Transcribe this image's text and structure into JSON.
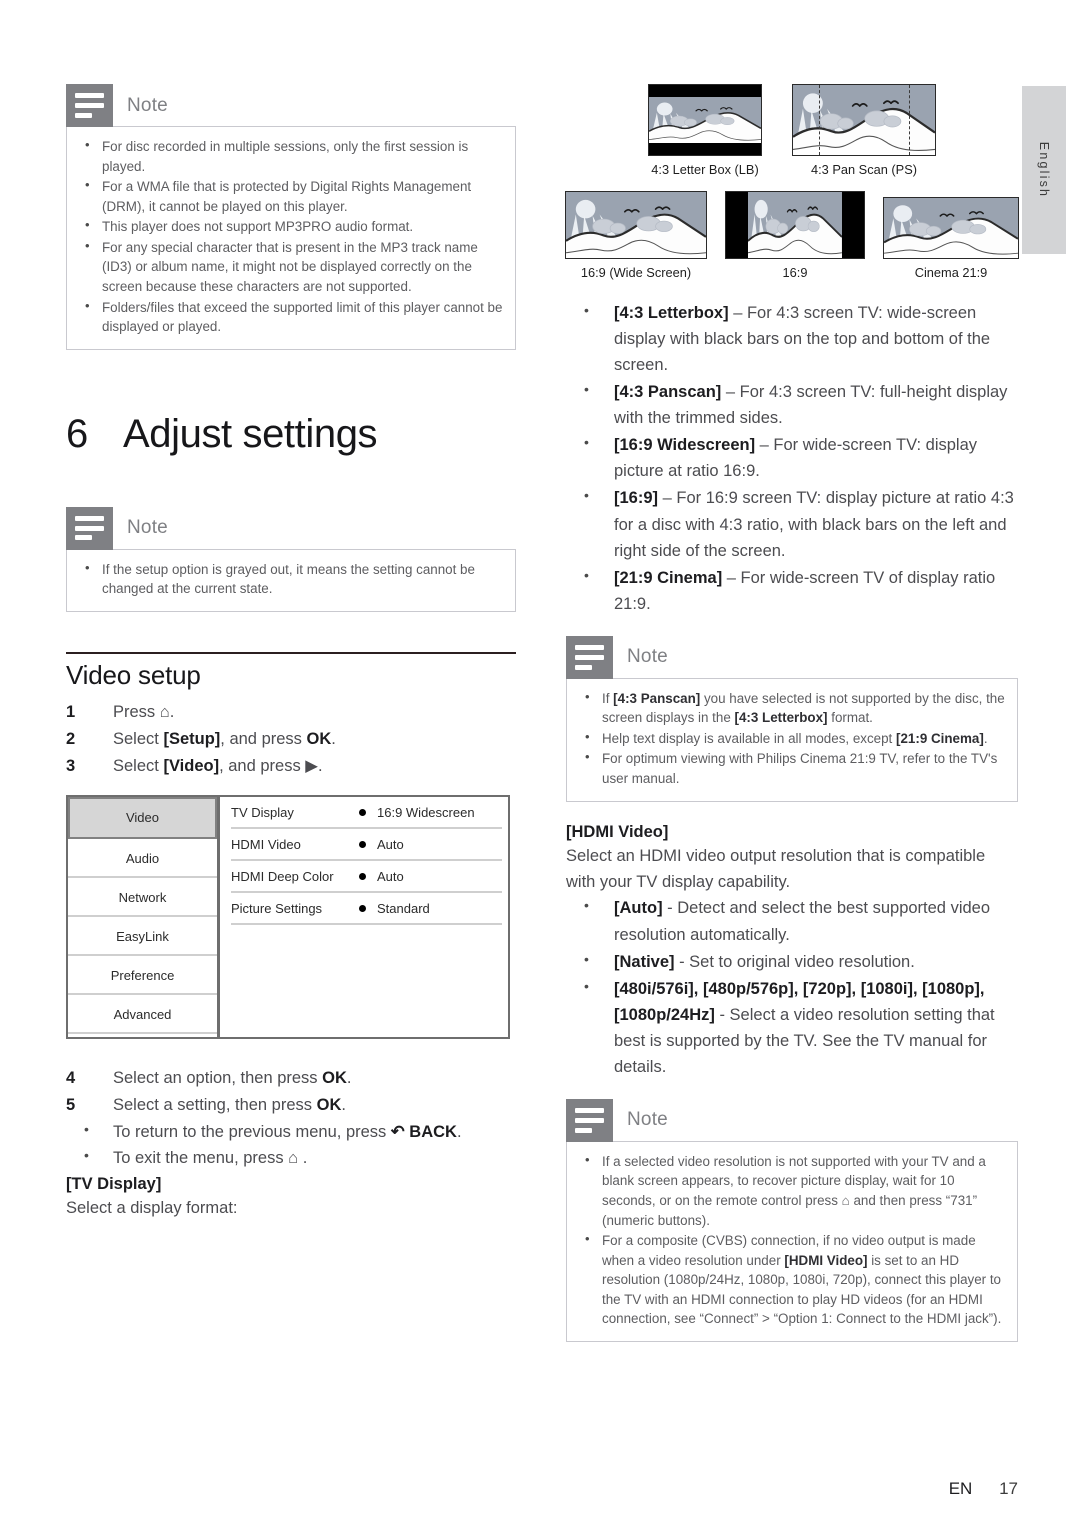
{
  "page": {
    "language_tab": "English",
    "footer_lang": "EN",
    "footer_page": "17"
  },
  "note1": {
    "title": "Note",
    "items": [
      "For disc recorded in multiple sessions, only the first session is played.",
      "For a WMA file that is protected by Digital Rights Management (DRM), it cannot be played on this player.",
      "This player does not support MP3PRO audio format.",
      "For any special character that is present in the MP3 track name (ID3) or album name, it might not be displayed correctly on the screen because these characters are not supported.",
      "Folders/files that exceed the supported limit of this player cannot be displayed or played."
    ]
  },
  "chapter": {
    "number": "6",
    "title": "Adjust settings"
  },
  "note2": {
    "title": "Note",
    "items": [
      "If the setup option is grayed out, it means the setting cannot be changed at the current state."
    ]
  },
  "video_setup": {
    "heading": "Video setup",
    "steps": [
      {
        "n": "1",
        "text": "Press ⌂."
      },
      {
        "n": "2",
        "text": "Select [Setup], and press OK."
      },
      {
        "n": "3",
        "text": "Select [Video], and press ▶."
      }
    ],
    "steps_after": [
      {
        "n": "4",
        "text": "Select an option, then press OK."
      },
      {
        "n": "5",
        "text": "Select a setting, then press OK."
      }
    ],
    "sub_bullets": [
      "To return to the previous menu, press ↶ BACK.",
      "To exit the menu, press ⌂ ."
    ]
  },
  "setup_menu": {
    "sidebar": [
      "Video",
      "Audio",
      "Network",
      "EasyLink",
      "Preference",
      "Advanced"
    ],
    "selected_sidebar": "Video",
    "rows": [
      {
        "label": "TV Display",
        "value": "16:9 Widescreen"
      },
      {
        "label": "HDMI Video",
        "value": "Auto"
      },
      {
        "label": "HDMI Deep Color",
        "value": "Auto"
      },
      {
        "label": "Picture Settings",
        "value": "Standard"
      }
    ]
  },
  "tv_display": {
    "heading": "[TV Display]",
    "intro": "Select a display format:",
    "figures_row1": [
      {
        "caption": "4:3 Letter Box (LB)",
        "mode": "letterbox"
      },
      {
        "caption": "4:3 Pan Scan (PS)",
        "mode": "panscan"
      }
    ],
    "figures_row2": [
      {
        "caption": "16:9 (Wide Screen)",
        "mode": "wide"
      },
      {
        "caption": "16:9",
        "mode": "pillarbox"
      },
      {
        "caption": "Cinema 21:9",
        "mode": "cinema"
      }
    ],
    "options": [
      {
        "term": "[4:3 Letterbox]",
        "desc": " – For 4:3 screen TV: wide-screen display with black bars on the top and bottom of the screen."
      },
      {
        "term": "[4:3 Panscan]",
        "desc": " – For 4:3 screen TV: full-height display with the trimmed sides."
      },
      {
        "term": "[16:9 Widescreen]",
        "desc": " – For wide-screen TV: display picture at ratio 16:9."
      },
      {
        "term": "[16:9]",
        "desc": " – For 16:9 screen TV: display picture at ratio 4:3 for a disc with 4:3 ratio, with black bars on the left and right side of the screen."
      },
      {
        "term": "[21:9 Cinema]",
        "desc": " – For wide-screen TV of display ratio 21:9."
      }
    ]
  },
  "note3": {
    "title": "Note",
    "items_html": [
      "If <b>[4:3 Panscan]</b> you have selected is not supported by the disc, the screen displays in the <b>[4:3 Letterbox]</b> format.",
      "Help text display is available in all modes, except <b>[21:9 Cinema]</b>.",
      "For optimum viewing with Philips Cinema 21:9 TV, refer to the TV's user manual."
    ]
  },
  "hdmi_video": {
    "heading": "[HDMI Video]",
    "intro": "Select an HDMI video output resolution that is compatible with your TV display capability.",
    "options": [
      {
        "term": "[Auto]",
        "desc": " - Detect and select the best supported video resolution automatically."
      },
      {
        "term": "[Native]",
        "desc": " - Set to original video resolution."
      },
      {
        "term": "[480i/576i], [480p/576p], [720p], [1080i], [1080p], [1080p/24Hz]",
        "desc": " - Select a video resolution setting that best is supported by the TV. See the TV manual for details."
      }
    ]
  },
  "note4": {
    "title": "Note",
    "items_html": [
      "If a selected video resolution is not supported with your TV and a blank screen appears, to recover picture display, wait for 10 seconds, or on the remote control press ⌂ and then press “731” (numeric buttons).",
      "For a composite (CVBS) connection, if no video output is made when a video resolution under <b>[HDMI Video]</b> is set to an HD resolution (1080p/24Hz, 1080p, 1080i, 720p), connect this player to the TV with an HDMI connection to play HD videos (for an HDMI connection, see “Connect” > “Option 1: Connect to the HDMI jack”)."
    ]
  }
}
